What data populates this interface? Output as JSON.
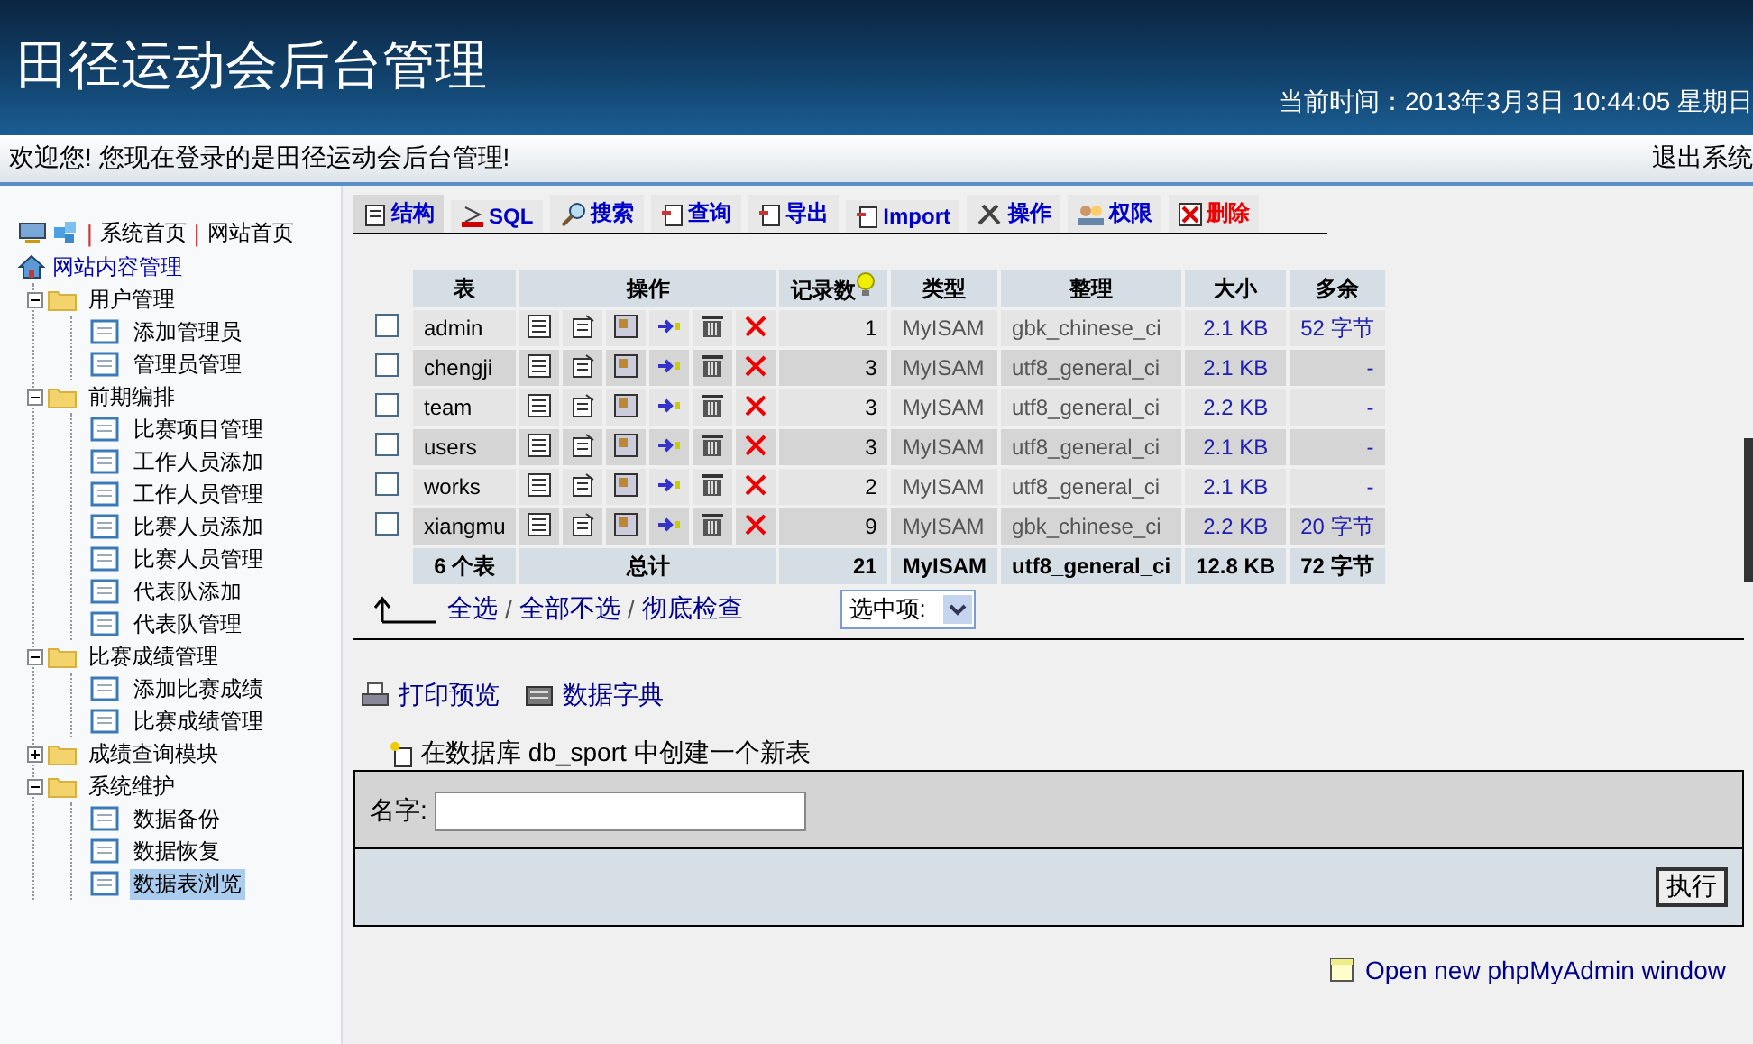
{
  "header": {
    "title": "田径运动会后台管理",
    "time": "当前时间：2013年3月3日  10:44:05 星期日"
  },
  "welcome": {
    "text": "欢迎您! 您现在登录的是田径运动会后台管理!",
    "logout": "退出系统"
  },
  "sidebar": {
    "top_links": [
      {
        "sep": "|",
        "label": "系统首页"
      },
      {
        "sep": "|",
        "label": "网站首页"
      }
    ],
    "root": "网站内容管理",
    "tree": [
      {
        "label": "用户管理",
        "expanded": true,
        "children": [
          {
            "label": "添加管理员",
            "selected": false
          },
          {
            "label": "管理员管理",
            "selected": false
          }
        ]
      },
      {
        "label": "前期编排",
        "expanded": true,
        "children": [
          {
            "label": "比赛项目管理",
            "selected": false
          },
          {
            "label": "工作人员添加",
            "selected": false
          },
          {
            "label": "工作人员管理",
            "selected": false
          },
          {
            "label": "比赛人员添加",
            "selected": false
          },
          {
            "label": "比赛人员管理",
            "selected": false
          },
          {
            "label": "代表队添加",
            "selected": false
          },
          {
            "label": "代表队管理",
            "selected": false
          }
        ]
      },
      {
        "label": "比赛成绩管理",
        "expanded": true,
        "children": [
          {
            "label": "添加比赛成绩",
            "selected": false
          },
          {
            "label": "比赛成绩管理",
            "selected": false
          }
        ]
      },
      {
        "label": "成绩查询模块",
        "expanded": false
      },
      {
        "label": "系统维护",
        "expanded": true,
        "children": [
          {
            "label": "数据备份",
            "selected": false
          },
          {
            "label": "数据恢复",
            "selected": false
          },
          {
            "label": "数据表浏览",
            "selected": true
          }
        ]
      }
    ]
  },
  "tabs": [
    {
      "label": "结构",
      "kind": "structure",
      "selected": true,
      "color": "#0000cc"
    },
    {
      "label": "SQL",
      "kind": "sql",
      "selected": false,
      "color": "#0000cc"
    },
    {
      "label": "搜索",
      "kind": "search",
      "selected": false,
      "color": "#0000cc"
    },
    {
      "label": "查询",
      "kind": "query",
      "selected": false,
      "color": "#0000cc"
    },
    {
      "label": "导出",
      "kind": "export",
      "selected": false,
      "color": "#0000cc"
    },
    {
      "label": "Import",
      "kind": "import",
      "selected": false,
      "color": "#0000cc"
    },
    {
      "label": "操作",
      "kind": "operations",
      "selected": false,
      "color": "#0000cc"
    },
    {
      "label": "权限",
      "kind": "privileges",
      "selected": false,
      "color": "#0000cc"
    },
    {
      "label": "删除",
      "kind": "drop",
      "selected": false,
      "color": "#ee0000"
    }
  ],
  "table": {
    "columns": [
      "表",
      "操作",
      "记录数",
      "类型",
      "整理",
      "大小",
      "多余"
    ],
    "rows": [
      {
        "name": "admin",
        "checked": false,
        "records": "1",
        "type": "MyISAM",
        "collation": "gbk_chinese_ci",
        "size": "2.1 KB",
        "overhead": "52 字节"
      },
      {
        "name": "chengji",
        "checked": false,
        "records": "3",
        "type": "MyISAM",
        "collation": "utf8_general_ci",
        "size": "2.1 KB",
        "overhead": "-"
      },
      {
        "name": "team",
        "checked": false,
        "records": "3",
        "type": "MyISAM",
        "collation": "utf8_general_ci",
        "size": "2.2 KB",
        "overhead": "-"
      },
      {
        "name": "users",
        "checked": false,
        "records": "3",
        "type": "MyISAM",
        "collation": "utf8_general_ci",
        "size": "2.1 KB",
        "overhead": "-"
      },
      {
        "name": "works",
        "checked": false,
        "records": "2",
        "type": "MyISAM",
        "collation": "utf8_general_ci",
        "size": "2.1 KB",
        "overhead": "-"
      },
      {
        "name": "xiangmu",
        "checked": false,
        "records": "9",
        "type": "MyISAM",
        "collation": "gbk_chinese_ci",
        "size": "2.2 KB",
        "overhead": "20 字节"
      }
    ],
    "total": {
      "name": "6 个表",
      "label": "总计",
      "records": "21",
      "type": "MyISAM",
      "collation": "utf8_general_ci",
      "size": "12.8 KB",
      "overhead": "72 字节"
    }
  },
  "selection": {
    "links": [
      {
        "label": "全选"
      },
      {
        "sep": "/",
        "label": "全部不选"
      },
      {
        "sep": "/",
        "label": "彻底检查"
      }
    ],
    "dropdown": "选中项:"
  },
  "print_links": [
    "打印预览",
    "数据字典"
  ],
  "create_table": {
    "legend": "在数据库 db_sport 中创建一个新表",
    "name_label": "名字:",
    "button": "执行"
  },
  "footer_link": "Open new phpMyAdmin window"
}
